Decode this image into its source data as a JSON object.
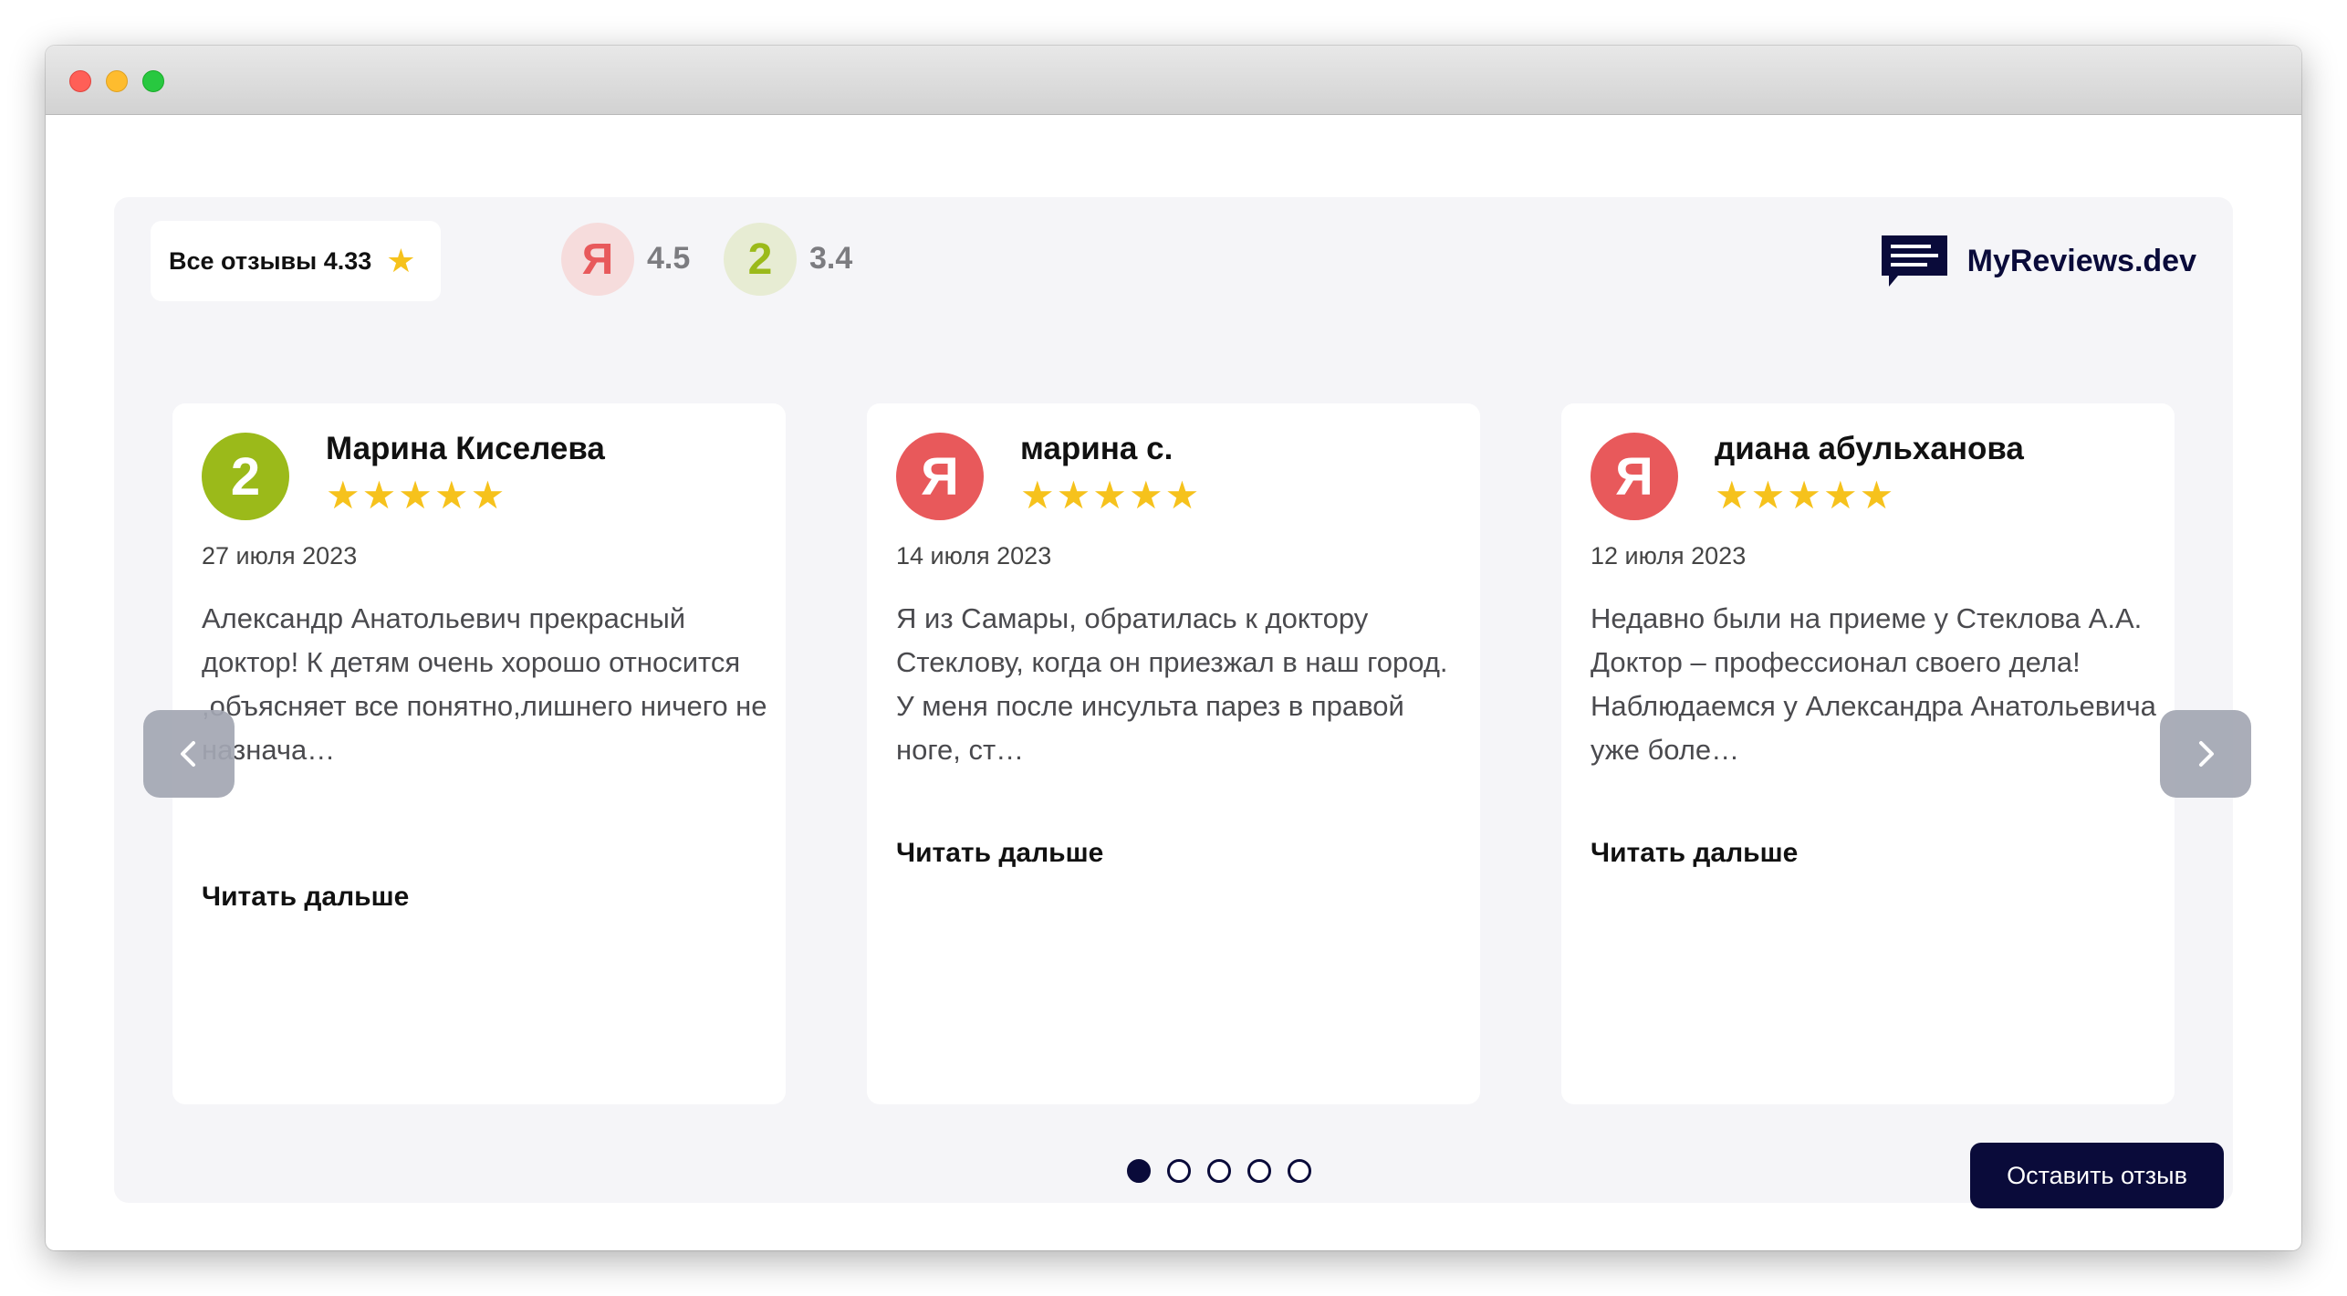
{
  "summary": {
    "all_reviews_label": "Все отзывы 4.33",
    "sources": [
      {
        "name": "yandex",
        "badge": "Я",
        "rating": "4.5"
      },
      {
        "name": "2gis",
        "badge": "2",
        "rating": "3.4"
      }
    ]
  },
  "brand": {
    "name": "MyReviews.dev"
  },
  "reviews": [
    {
      "source": "2gis",
      "avatar": "2",
      "author": "Марина Киселева",
      "stars": "★★★★★",
      "rating": 5,
      "date": "27 июля 2023",
      "text": "Александр Анатольевич прекрасный доктор! К детям очень хорошо относится ,объясняет все понятно,лишнего ничего не назнача…",
      "read_more": "Читать дальше"
    },
    {
      "source": "yandex",
      "avatar": "Я",
      "author": "марина с.",
      "stars": "★★★★★",
      "rating": 5,
      "date": "14 июля 2023",
      "text": "Я из Самары, обратилась к доктору Стеклову, когда он приезжал в наш город. У меня после инсульта парез в правой ноге, ст…",
      "read_more": "Читать дальше"
    },
    {
      "source": "yandex",
      "avatar": "Я",
      "author": "диана абульханова",
      "stars": "★★★★★",
      "rating": 5,
      "date": "12 июля 2023",
      "text": "Недавно были на приеме у Стеклова А.А. Доктор – профессионал своего дела! Наблюдаемся у Александра Анатольевича уже боле…",
      "read_more": "Читать дальше"
    }
  ],
  "pagination": {
    "total": 5,
    "active": 1
  },
  "leave_review_label": "Оставить отзыв",
  "colors": {
    "accent": "#0a0b3a",
    "star": "#f6c21c",
    "yandex": "#e8595b",
    "twogis": "#9bba1a"
  },
  "icons": {
    "prev": "chevron-left-icon",
    "next": "chevron-right-icon",
    "star": "star-icon",
    "brand": "chat-bubble-icon"
  }
}
